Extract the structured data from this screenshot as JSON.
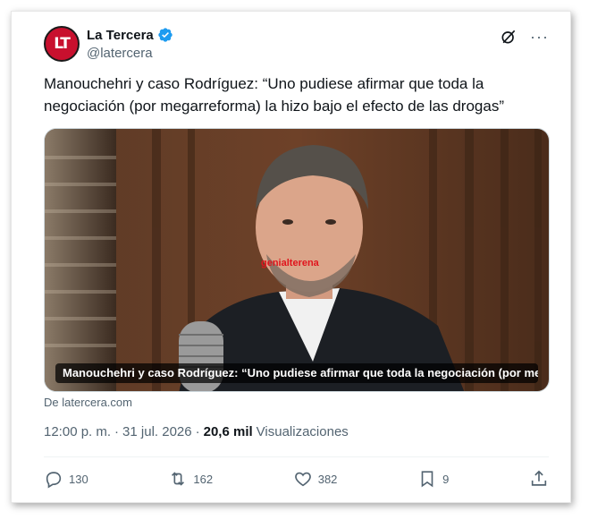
{
  "account": {
    "avatar_text": "LT",
    "display_name": "La Tercera",
    "handle": "@latercera"
  },
  "top_icons": {
    "grok": "grok-icon",
    "more": "more-icon",
    "more_glyph": "···"
  },
  "tweet": {
    "text": "Manouchehri y caso Rodríguez: “Uno pudiese afirmar que toda la negociación (por megarreforma) la hizo bajo el efecto de las drogas”"
  },
  "media": {
    "watermark": "genialterena",
    "caption": "Manouchehri y caso Rodríguez: “Uno pudiese afirmar que toda la negociación (por me…",
    "source": "De latercera.com"
  },
  "meta": {
    "time": "12:00 p. m.",
    "separator": "·",
    "date": "31 jul. 2026",
    "separator2": "·",
    "views_count": "20,6 mil",
    "views_label": "Visualizaciones"
  },
  "actions": {
    "replies": "130",
    "reposts": "162",
    "likes": "382",
    "bookmarks": "9"
  },
  "colors": {
    "brand_red": "#c8102e",
    "verified_blue": "#1d9bf0",
    "secondary_text": "#536471"
  }
}
